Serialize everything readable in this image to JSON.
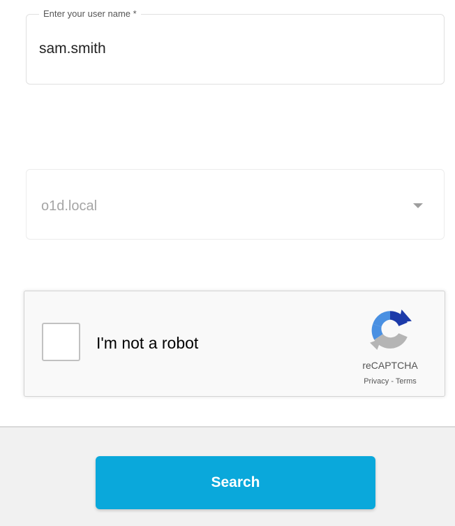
{
  "form": {
    "username": {
      "label": "Enter your user name *",
      "value": "sam.smith"
    },
    "domain": {
      "selected": "o1d.local",
      "icon": "chevron-down-icon"
    }
  },
  "recaptcha": {
    "label": "I'm not a robot",
    "checked": false,
    "brand": "reCAPTCHA",
    "privacy_label": "Privacy",
    "separator": " - ",
    "terms_label": "Terms",
    "logo_icon": "recaptcha-logo-icon",
    "colors": {
      "blue": "#4a90e2",
      "dark_blue": "#1c3aa9",
      "gray": "#b5b5b5"
    }
  },
  "footer": {
    "search_label": "Search",
    "button_color": "#0aa8db",
    "background": "#f1f1f1"
  }
}
